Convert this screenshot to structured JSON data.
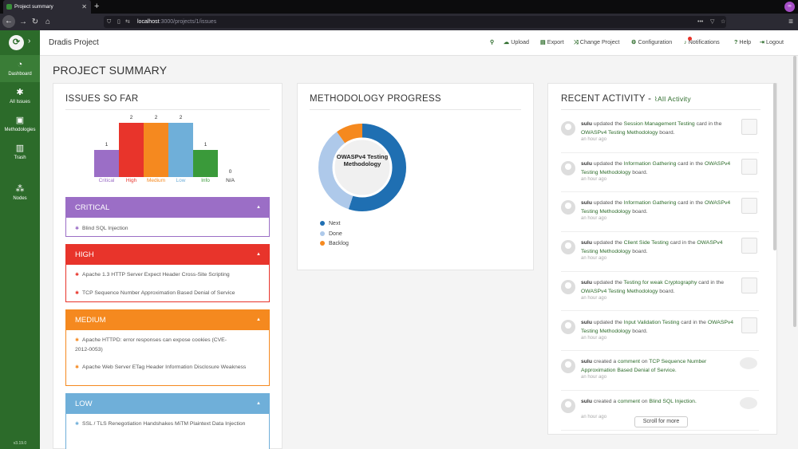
{
  "browser": {
    "tab_title": "Project summary",
    "url_host": "localhost",
    "url_path": ":3000/projects/1/issues",
    "profile_initial": "∞"
  },
  "sidebar": {
    "items": [
      {
        "label": "Dashboard",
        "icon": "dashboard-icon"
      },
      {
        "label": "All Issues",
        "icon": "bug-icon"
      },
      {
        "label": "Methodologies",
        "icon": "book-icon"
      },
      {
        "label": "Trash",
        "icon": "trash-icon"
      },
      {
        "label": "Nodes",
        "icon": "sitemap-icon"
      }
    ],
    "version": "v3.19.0"
  },
  "header": {
    "project_name": "Dradis Project",
    "nav": [
      {
        "label": "Upload",
        "icon": "upload-icon"
      },
      {
        "label": "Export",
        "icon": "export-icon"
      },
      {
        "label": "Change Project",
        "icon": "shuffle-icon"
      },
      {
        "label": "Configuration",
        "icon": "gear-icon"
      },
      {
        "label": "Notifications",
        "icon": "bell-icon"
      },
      {
        "label": "Help",
        "icon": "help-icon"
      },
      {
        "label": "Logout",
        "icon": "logout-icon"
      }
    ]
  },
  "page_title": "PROJECT SUMMARY",
  "issues_panel": {
    "title": "ISSUES SO FAR",
    "chart_data": {
      "type": "bar",
      "categories": [
        "Critical",
        "High",
        "Medium",
        "Low",
        "Info",
        "N/A"
      ],
      "values": [
        1,
        2,
        2,
        2,
        1,
        0
      ],
      "colors": [
        "#9b6ec6",
        "#e8342b",
        "#f5891f",
        "#6fafd9",
        "#3a9a3a",
        "#999999"
      ],
      "ylim": [
        0,
        2
      ]
    },
    "groups": [
      {
        "name": "CRITICAL",
        "color": "#9b6ec6",
        "issues": [
          "Blind SQL Injection"
        ]
      },
      {
        "name": "HIGH",
        "color": "#e8342b",
        "issues": [
          "Apache 1.3 HTTP Server Expect Header Cross-Site Scripting",
          "TCP Sequence Number Approximation Based Denial of Service"
        ]
      },
      {
        "name": "MEDIUM",
        "color": "#f5891f",
        "issues": [
          "Apache HTTPD: error responses can expose cookies (CVE-2012-0053)",
          "Apache Web Server ETag Header Information Disclosure Weakness"
        ]
      },
      {
        "name": "LOW",
        "color": "#6fafd9",
        "issues": [
          "SSL / TLS Renegotiation Handshakes MiTM Plaintext Data Injection"
        ]
      }
    ]
  },
  "methodology_panel": {
    "title": "METHODOLOGY PROGRESS",
    "center_label": "OWASPv4 Testing Methodology",
    "chart_data": {
      "type": "pie",
      "labels": [
        "Next",
        "Done",
        "Backlog"
      ],
      "values": [
        55,
        35,
        10
      ],
      "colors": [
        "#1f6fb2",
        "#aec9ea",
        "#f5891f"
      ]
    }
  },
  "activity_panel": {
    "title": "RECENT ACTIVITY -",
    "all_link": "All Activity",
    "items": [
      {
        "user": "sulu",
        "verb": "updated the",
        "target": "Session Management Testing",
        "mid": "card in the",
        "target2": "OWASPv4 Testing Methodology",
        "end": "board.",
        "ago": "an hour ago",
        "kind": "card"
      },
      {
        "user": "sulu",
        "verb": "updated the",
        "target": "Information Gathering",
        "mid": "card in the",
        "target2": "OWASPv4 Testing Methodology",
        "end": "board.",
        "ago": "an hour ago",
        "kind": "card"
      },
      {
        "user": "sulu",
        "verb": "updated the",
        "target": "Information Gathering",
        "mid": "card in the",
        "target2": "OWASPv4 Testing Methodology",
        "end": "board.",
        "ago": "an hour ago",
        "kind": "card"
      },
      {
        "user": "sulu",
        "verb": "updated the",
        "target": "Client Side Testing",
        "mid": "card in the",
        "target2": "OWASPv4 Testing Methodology",
        "end": "board.",
        "ago": "an hour ago",
        "kind": "card"
      },
      {
        "user": "sulu",
        "verb": "updated the",
        "target": "Testing for weak Cryptography",
        "mid": "card in the",
        "target2": "OWASPv4 Testing Methodology",
        "end": "board.",
        "ago": "an hour ago",
        "kind": "card"
      },
      {
        "user": "sulu",
        "verb": "updated the",
        "target": "Input Validation Testing",
        "mid": "card in the",
        "target2": "OWASPv4 Testing Methodology",
        "end": "board.",
        "ago": "an hour ago",
        "kind": "card"
      },
      {
        "user": "sulu",
        "verb": "created a",
        "target": "comment",
        "mid": "on",
        "target2": "TCP Sequence Number Approximation Based Denial of Service.",
        "end": "",
        "ago": "an hour ago",
        "kind": "comment"
      },
      {
        "user": "sulu",
        "verb": "created a",
        "target": "comment",
        "mid": "on",
        "target2": "Blind SQL Injection.",
        "end": "",
        "ago": "an hour ago",
        "kind": "comment"
      }
    ],
    "scroll_button": "Scroll for more"
  }
}
